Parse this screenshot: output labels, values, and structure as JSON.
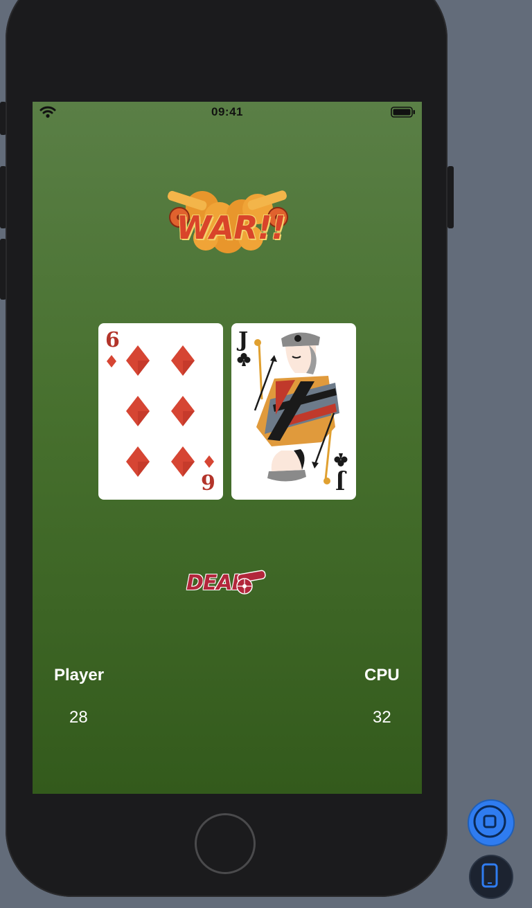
{
  "status_bar": {
    "time": "09:41"
  },
  "logo": {
    "text": "WAR!!"
  },
  "cards": {
    "player": {
      "rank": "6",
      "suit": "diamonds",
      "color": "#b3342a"
    },
    "cpu": {
      "rank": "J",
      "suit": "clubs",
      "color": "#1a1a1a"
    }
  },
  "deal_button": {
    "label": "DEAL"
  },
  "scores": {
    "player_label": "Player",
    "player_score": "28",
    "cpu_label": "CPU",
    "cpu_score": "32"
  },
  "colors": {
    "background_top": "#5a7f46",
    "background_bottom": "#335a1c",
    "accent_blue": "#2f7cf0"
  },
  "icons": [
    "wifi-icon",
    "battery-icon",
    "home-icon",
    "device-rotate-icon"
  ]
}
